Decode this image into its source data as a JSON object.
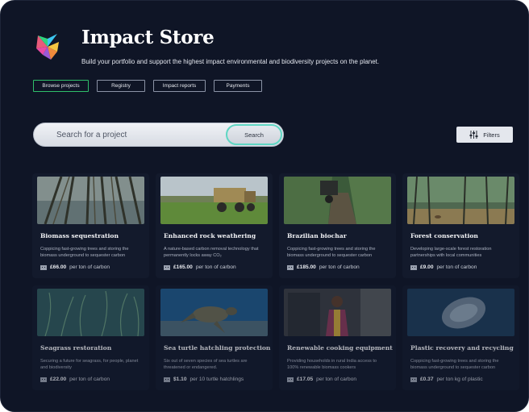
{
  "app": {
    "title": "Impact Store",
    "subtitle": "Build your portfolio and support the highest impact environmental and biodiversity projects on the planet."
  },
  "tabs": [
    {
      "label": "Browse projects",
      "active": true
    },
    {
      "label": "Registry",
      "active": false
    },
    {
      "label": "Impact reports",
      "active": false
    },
    {
      "label": "Payments",
      "active": false
    }
  ],
  "search": {
    "placeholder": "Search for a project",
    "button_label": "Search"
  },
  "filters": {
    "label": "Filters"
  },
  "colors": {
    "background": "#0f1526",
    "card": "#131a2c",
    "active_tab_border": "#2fbf6a",
    "search_button_ring": "#5ed6c3"
  },
  "projects": [
    {
      "title": "Biomass sequestration",
      "description": "Coppicing fast-growing trees and storing the biomass underground to sequester carbon",
      "price": "£66.00",
      "unit": "per ton of carbon",
      "image": "forest-canopy-photo"
    },
    {
      "title": "Enhanced rock weathering",
      "description": "A nature-based carbon removal technology that permanently locks away CO₂",
      "price": "£165.00",
      "unit": "per ton of carbon",
      "image": "tractor-field-photo"
    },
    {
      "title": "Brazilian biochar",
      "description": "Coppicing fast-growing trees and storing the biomass underground to sequester carbon",
      "price": "£185.00",
      "unit": "per ton of carbon",
      "image": "tree-plantation-photo"
    },
    {
      "title": "Forest conservation",
      "description": "Developing large-scale forest restoration partnerships with local communities",
      "price": "£9.00",
      "unit": "per ton of carbon",
      "image": "forest-clearing-photo"
    },
    {
      "title": "Seagrass restoration",
      "description": "Securing a future for seagrass, for people, planet and biodiversity",
      "price": "£22.00",
      "unit": "per ton of carbon",
      "image": "seagrass-photo"
    },
    {
      "title": "Sea turtle hatchling protection",
      "description": "Six out of seven species of sea turtles are threatened or endangered.",
      "price": "$1.10",
      "unit": "per 10 turtle hatchlings",
      "image": "sea-turtle-photo"
    },
    {
      "title": "Renewable cooking equipment",
      "description": "Providing households in rural India access to 100% renewable biomass cookers",
      "price": "£17.05",
      "unit": "per ton of carbon",
      "image": "cook-woman-photo"
    },
    {
      "title": "Plastic recovery and recycling",
      "description": "Coppicing fast-growing trees and storing the biomass underground to sequester carbon",
      "price": "£0.37",
      "unit": "per ton kg of plastic",
      "image": "plastic-bag-underwater-photo"
    }
  ]
}
